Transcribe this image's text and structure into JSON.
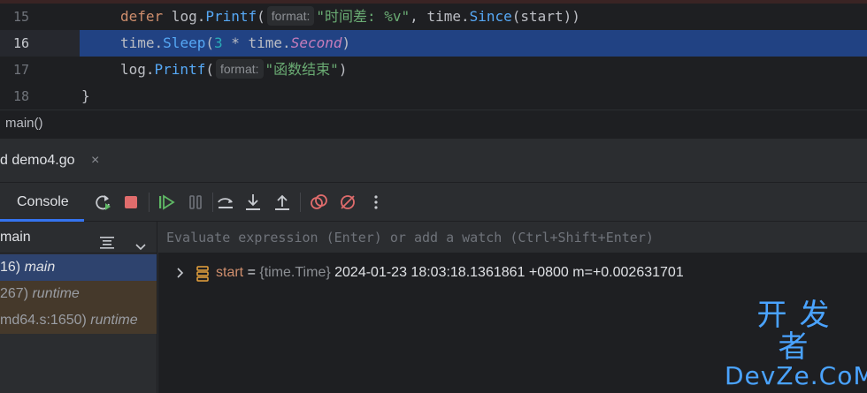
{
  "editor": {
    "lines": [
      {
        "num": "15",
        "t1": "defer",
        "t2": " log.",
        "t3": "Printf",
        "t4": "(",
        "hint": "format:",
        "t5": "\"时间差: %v\"",
        "t6": ", time.",
        "t7": "Since",
        "t8": "(start))"
      },
      {
        "num": "16",
        "t1": "time.",
        "t2": "Sleep",
        "t3": "(",
        "t4": "3",
        "t5": " * time.",
        "t6": "Second",
        "t7": ")"
      },
      {
        "num": "17",
        "t1": "log.",
        "t2": "Printf",
        "t3": "(",
        "hint": "format:",
        "t4": "\"函数结束\"",
        "t5": ")"
      },
      {
        "num": "18",
        "t1": "}"
      }
    ],
    "breadcrumb": "main()"
  },
  "debug": {
    "tab_label": "d demo4.go",
    "tab_close": "×",
    "console_label": "Console",
    "frames_header": "main",
    "frames": [
      {
        "loc": "16) ",
        "func": "main",
        "selected": true
      },
      {
        "loc": "267) ",
        "func": "runtime",
        "selected": false
      },
      {
        "loc": "md64.s:1650) ",
        "func": "runtime",
        "selected": false
      }
    ],
    "eval_placeholder": "Evaluate expression (Enter) or add a watch (Ctrl+Shift+Enter)",
    "variable": {
      "name": "start",
      "eq": " = ",
      "type": "{time.Time}",
      "value": " 2024-01-23 18:03:18.1361861 +0800 m=+0.002631701"
    }
  },
  "watermark": {
    "top": "开发者",
    "bottom": "DevZe.CoM"
  },
  "colors": {
    "selection": "#214283",
    "accent": "#3574f0",
    "frame_selected": "#2e436e",
    "frame_other": "#45392b"
  }
}
